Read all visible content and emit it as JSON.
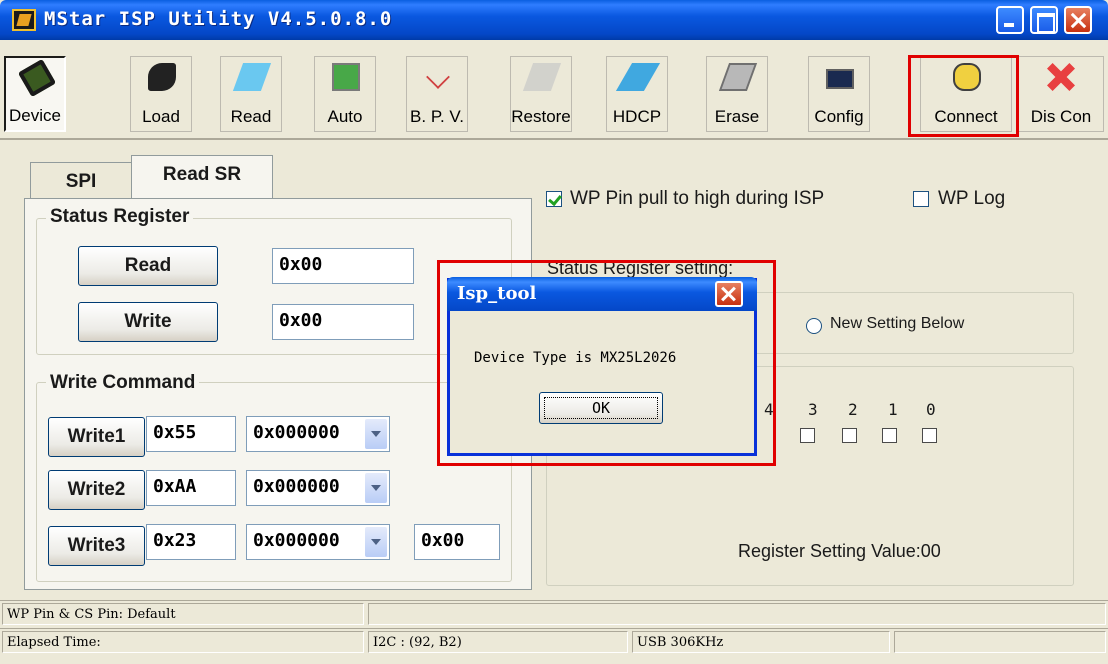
{
  "window": {
    "title": "MStar ISP Utility V4.5.0.8.0"
  },
  "toolbar": {
    "buttons": [
      {
        "label": "Device",
        "icon": "chip-icon"
      },
      {
        "label": "Load",
        "icon": "load-icon"
      },
      {
        "label": "Read",
        "icon": "read-icon"
      },
      {
        "label": "Auto",
        "icon": "auto-icon"
      },
      {
        "label": "B. P. V.",
        "icon": "blank-program-verify-icon"
      },
      {
        "label": "Restore",
        "icon": "restore-icon"
      },
      {
        "label": "HDCP",
        "icon": "hdcp-icon"
      },
      {
        "label": "Erase",
        "icon": "erase-icon"
      },
      {
        "label": "Config",
        "icon": "config-icon"
      },
      {
        "label": "Connect",
        "icon": "connect-icon"
      },
      {
        "label": "Dis Con",
        "icon": "disconnect-icon"
      }
    ],
    "highlight_color": "#e00000"
  },
  "tabs": [
    {
      "label": "SPI"
    },
    {
      "label": "Read SR",
      "active": true
    }
  ],
  "status_register": {
    "title": "Status Register",
    "read_label": "Read",
    "read_value": "0x00",
    "write_label": "Write",
    "write_value": "0x00"
  },
  "write_command": {
    "title": "Write Command",
    "rows": [
      {
        "label": "Write1",
        "cmd": "0x55",
        "addr": "0x000000"
      },
      {
        "label": "Write2",
        "cmd": "0xAA",
        "addr": "0x000000"
      },
      {
        "label": "Write3",
        "cmd": "0x23",
        "addr": "0x000000",
        "extra": "0x00"
      }
    ]
  },
  "options": {
    "wp_pull_label": "WP Pin pull to high during ISP",
    "wp_pull_checked": true,
    "wp_log_label": "WP Log",
    "wp_log_checked": false
  },
  "sr_setting": {
    "label": "Status Register setting:",
    "new_setting_label": "New Setting Below",
    "bits": [
      "4",
      "3",
      "2",
      "1",
      "0"
    ],
    "value_label": "Register Setting Value:00"
  },
  "dialog": {
    "title": "Isp_tool",
    "message": "Device Type is MX25L2026",
    "ok_label": "OK"
  },
  "statusbar": {
    "row1": [
      "WP Pin & CS Pin: Default",
      ""
    ],
    "row2": [
      "Elapsed Time:",
      "I2C : (92, B2)",
      "USB  306KHz",
      ""
    ]
  }
}
